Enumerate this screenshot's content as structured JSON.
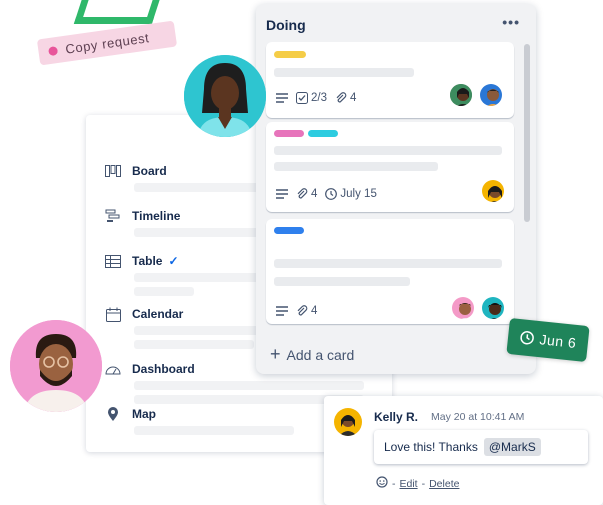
{
  "copy_tag": {
    "label": "Copy request"
  },
  "views": {
    "items": [
      {
        "label": "Board",
        "icon": "board-icon",
        "checked": false
      },
      {
        "label": "Timeline",
        "icon": "timeline-icon",
        "checked": false
      },
      {
        "label": "Table",
        "icon": "table-icon",
        "checked": true,
        "check_mark": "✓"
      },
      {
        "label": "Calendar",
        "icon": "calendar-icon",
        "checked": false
      },
      {
        "label": "Dashboard",
        "icon": "dashboard-icon",
        "checked": false
      },
      {
        "label": "Map",
        "icon": "map-pin-icon",
        "checked": false
      }
    ]
  },
  "list": {
    "title": "Doing",
    "more_glyph": "•••",
    "add_card_label": "Add a card",
    "cards": [
      {
        "labels": [
          "#f5cd47"
        ],
        "checklist": "2/3",
        "attachments": "4",
        "due": "",
        "members": [
          "dark-skin-woman-avatar",
          "blue-avatar"
        ]
      },
      {
        "labels": [
          "#e774bb",
          "#2dcce0"
        ],
        "checklist": "",
        "attachments": "4",
        "due": "July 15",
        "members": [
          "yellow-avatar"
        ]
      },
      {
        "labels": [
          "#2f80ed"
        ],
        "checklist": "",
        "attachments": "4",
        "due": "",
        "members": [
          "pink-avatar",
          "teal-avatar"
        ]
      }
    ]
  },
  "date_badge": {
    "label": "Jun 6",
    "color": "#1f845a"
  },
  "comment": {
    "author": "Kelly R.",
    "time": "May 20 at 10:41 AM",
    "text": "Love this! Thanks",
    "mention": "@MarkS",
    "edit_label": "Edit",
    "delete_label": "Delete",
    "separator": "-"
  },
  "colors": {
    "accent_green": "#2fb86a",
    "tag_pink": "#f7d6e4",
    "list_bg": "#f1f2f4"
  }
}
